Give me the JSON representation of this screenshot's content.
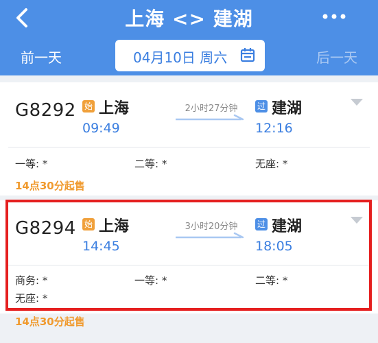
{
  "header": {
    "title": "上海 <> 建湖",
    "prev_day": "前一天",
    "next_day": "后一天",
    "date": "04月10日 周六"
  },
  "trains": [
    {
      "number": "G8292",
      "from_badge": "始",
      "from_station": "上海",
      "depart": "09:49",
      "duration": "2小时27分钟",
      "to_badge": "过",
      "to_station": "建湖",
      "arrive": "12:16",
      "seats": [
        "一等: *",
        "二等: *",
        "无座: *"
      ],
      "sale": "14点30分起售"
    },
    {
      "number": "G8294",
      "from_badge": "始",
      "from_station": "上海",
      "depart": "14:45",
      "duration": "3小时20分钟",
      "to_badge": "过",
      "to_station": "建湖",
      "arrive": "18:05",
      "seats": [
        "商务: *",
        "一等: *",
        "二等: *",
        "无座: *"
      ],
      "sale": "14点30分起售"
    }
  ],
  "colors": {
    "header_bg": "#4d8fe6",
    "accent": "#3a7ee0",
    "sale_text": "#f09a2e",
    "highlight_border": "#e51f1f"
  },
  "icons": {
    "back": "chevron-left-icon",
    "more": "more-dots-icon",
    "calendar": "calendar-icon",
    "expand": "chevron-down-icon"
  }
}
